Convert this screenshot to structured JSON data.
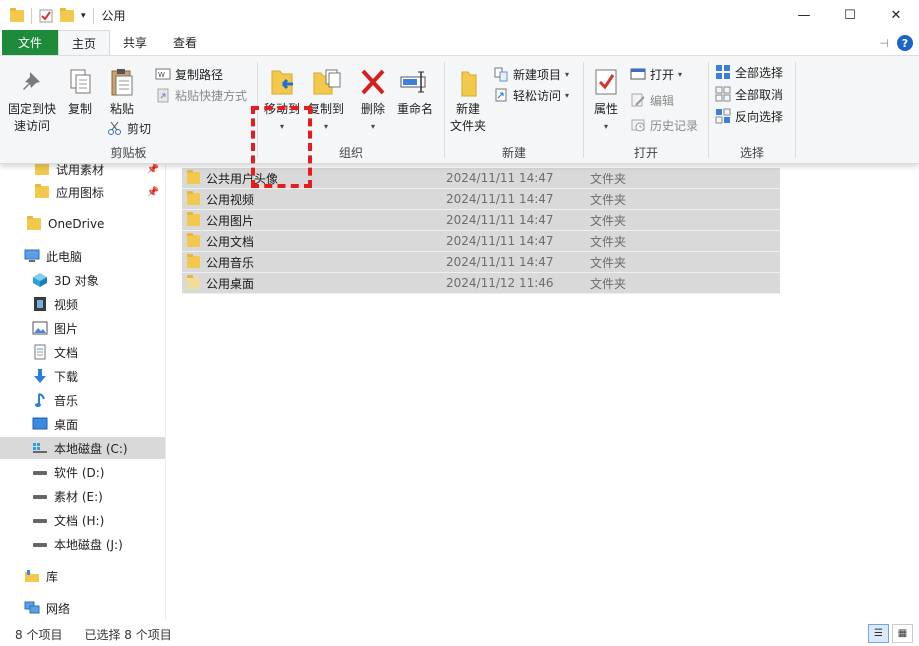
{
  "window": {
    "title": "公用",
    "minimize_glyph": "—",
    "maximize_glyph": "☐",
    "close_glyph": "✕"
  },
  "tabs": [
    {
      "label": "文件"
    },
    {
      "label": "主页"
    },
    {
      "label": "共享"
    },
    {
      "label": "查看"
    }
  ],
  "ribbon": {
    "clipboard": {
      "pin_quick_access_line1": "固定到快",
      "pin_quick_access_line2": "速访问",
      "copy": "复制",
      "paste": "粘贴",
      "copy_path": "复制路径",
      "paste_shortcut": "粘贴快捷方式",
      "cut": "剪切",
      "label": "剪贴板"
    },
    "organize": {
      "move_to": "移动到",
      "copy_to": "复制到",
      "delete": "删除",
      "rename": "重命名",
      "label": "组织"
    },
    "new": {
      "new_folder_line1": "新建",
      "new_folder_line2": "文件夹",
      "new_item": "新建项目",
      "easy_access": "轻松访问",
      "label": "新建"
    },
    "open": {
      "properties": "属性",
      "open": "打开",
      "edit": "编辑",
      "history": "历史记录",
      "label": "打开"
    },
    "select": {
      "select_all": "全部选择",
      "select_none": "全部取消",
      "invert": "反向选择",
      "label": "选择"
    }
  },
  "nav": {
    "quick_items": [
      "试用素材",
      "应用图标"
    ],
    "onedrive": "OneDrive",
    "this_pc": "此电脑",
    "pc_items": [
      "3D 对象",
      "视频",
      "图片",
      "文档",
      "下载",
      "音乐",
      "桌面"
    ],
    "drives": [
      "本地磁盘 (C:)",
      "软件 (D:)",
      "素材 (E:)",
      "文档 (H:)",
      "本地磁盘 (J:)"
    ],
    "library": "库",
    "network": "网络"
  },
  "files": [
    {
      "name": "公共用户头像",
      "date": "2024/11/11 14:47",
      "type": "文件夹"
    },
    {
      "name": "公用视频",
      "date": "2024/11/11 14:47",
      "type": "文件夹"
    },
    {
      "name": "公用图片",
      "date": "2024/11/11 14:47",
      "type": "文件夹"
    },
    {
      "name": "公用文档",
      "date": "2024/11/11 14:47",
      "type": "文件夹"
    },
    {
      "name": "公用音乐",
      "date": "2024/11/11 14:47",
      "type": "文件夹"
    },
    {
      "name": "公用桌面",
      "date": "2024/11/12 11:46",
      "type": "文件夹"
    }
  ],
  "status": {
    "count": "8 个项目",
    "selected": "已选择 8 个项目"
  },
  "colors": {
    "file_tab": "#1e8b3a",
    "highlight": "#e81c1c",
    "selection": "#d9d9d9"
  }
}
